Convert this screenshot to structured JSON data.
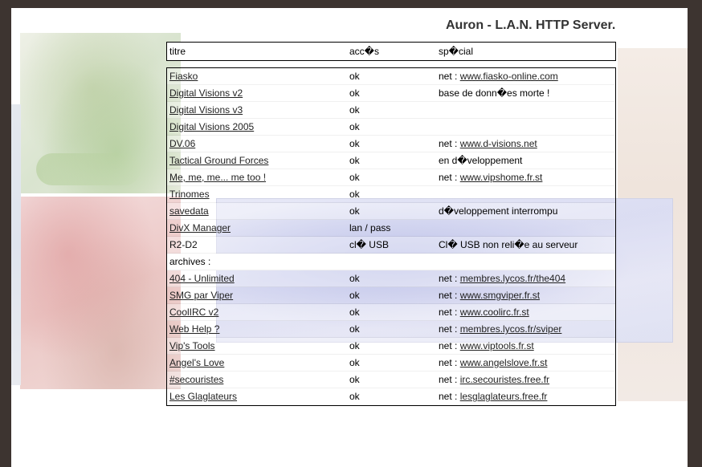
{
  "header": {
    "title": "Auron - L.A.N. HTTP Server."
  },
  "columns": {
    "title": "titre",
    "access": "acc�s",
    "special": "sp�cial"
  },
  "rows": [
    {
      "name": "Fiasko",
      "linked": true,
      "access": "ok",
      "special_prefix": "net : ",
      "special_link": "www.fiasko-online.com",
      "special_text": ""
    },
    {
      "name": "Digital Visions v2",
      "linked": true,
      "access": "ok",
      "special_prefix": "",
      "special_link": "",
      "special_text": "base de donn�es morte !"
    },
    {
      "name": "Digital Visions v3",
      "linked": true,
      "access": "ok",
      "special_prefix": "",
      "special_link": "",
      "special_text": ""
    },
    {
      "name": "Digital Visions 2005",
      "linked": true,
      "access": "ok",
      "special_prefix": "",
      "special_link": "",
      "special_text": ""
    },
    {
      "name": "DV.06",
      "linked": true,
      "access": "ok",
      "special_prefix": "net : ",
      "special_link": "www.d-visions.net",
      "special_text": ""
    },
    {
      "name": "Tactical Ground Forces",
      "linked": true,
      "access": "ok",
      "special_prefix": "",
      "special_link": "",
      "special_text": "en d�veloppement"
    },
    {
      "name": "Me, me, me... me too !",
      "linked": true,
      "access": "ok",
      "special_prefix": "net : ",
      "special_link": "www.vipshome.fr.st",
      "special_text": ""
    },
    {
      "name": "Trinomes",
      "linked": true,
      "access": "ok",
      "special_prefix": "",
      "special_link": "",
      "special_text": ""
    },
    {
      "name": "savedata",
      "linked": true,
      "access": "ok",
      "special_prefix": "",
      "special_link": "",
      "special_text": "d�veloppement interrompu"
    },
    {
      "name": "DivX Manager",
      "linked": true,
      "access": "lan / pass",
      "special_prefix": "",
      "special_link": "",
      "special_text": ""
    },
    {
      "name": "R2-D2",
      "linked": false,
      "access": "cl� USB",
      "special_prefix": "",
      "special_link": "",
      "special_text": "Cl� USB non reli�e au serveur"
    }
  ],
  "archives_label": "archives :",
  "archives": [
    {
      "name": "404 - Unlimited",
      "access": "ok",
      "special_prefix": "net : ",
      "special_link": "membres.lycos.fr/the404"
    },
    {
      "name": "SMG par Viper",
      "access": "ok",
      "special_prefix": "net : ",
      "special_link": "www.smgviper.fr.st"
    },
    {
      "name": "CoolIRC v2",
      "access": "ok",
      "special_prefix": "net : ",
      "special_link": "www.coolirc.fr.st"
    },
    {
      "name": "Web Help ?",
      "access": "ok",
      "special_prefix": "net : ",
      "special_link": "membres.lycos.fr/sviper"
    },
    {
      "name": "Vip's Tools",
      "access": "ok",
      "special_prefix": "net : ",
      "special_link": "www.viptools.fr.st"
    },
    {
      "name": "Angel's Love",
      "access": "ok",
      "special_prefix": "net : ",
      "special_link": "www.angelslove.fr.st"
    },
    {
      "name": "#secouristes",
      "access": "ok",
      "special_prefix": "net : ",
      "special_link": "irc.secouristes.free.fr"
    },
    {
      "name": "Les Glaglateurs",
      "access": "ok",
      "special_prefix": "net : ",
      "special_link": "lesglaglateurs.free.fr"
    }
  ]
}
